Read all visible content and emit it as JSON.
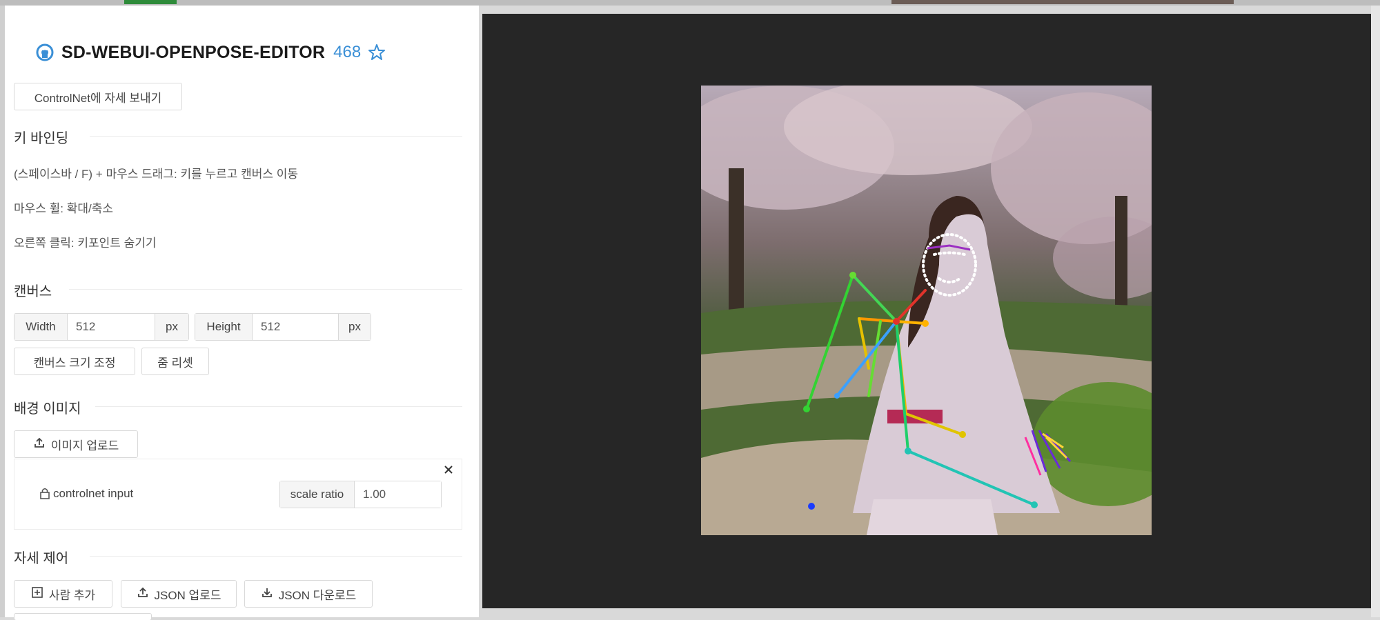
{
  "header": {
    "title": "SD-WEBUI-OPENPOSE-EDITOR",
    "stars": "468",
    "github_icon": "github-icon",
    "star_icon": "star-outline-icon"
  },
  "send_button": "ControlNet에 자세 보내기",
  "keybinding": {
    "title": "키 바인딩",
    "lines": [
      "(스페이스바 / F) + 마우스 드래그: 키를 누르고 캔버스 이동",
      "마우스 휠: 확대/축소",
      "오른쪽 클릭: 키포인트 숨기기"
    ]
  },
  "canvas": {
    "title": "캔버스",
    "width_label": "Width",
    "width_value": "512",
    "height_label": "Height",
    "height_value": "512",
    "unit": "px",
    "resize_button": "캔버스 크기 조정",
    "zoom_reset_button": "줌 리셋"
  },
  "background": {
    "title": "배경 이미지",
    "upload_button": "이미지 업로드",
    "card": {
      "layer_name": "controlnet input",
      "scale_label": "scale ratio",
      "scale_value": "1.00",
      "close_icon": "close-icon",
      "lock_icon": "lock-icon"
    }
  },
  "pose": {
    "title": "자세 제어",
    "add_person_button": "사람 추가",
    "json_upload_button": "JSON 업로드",
    "json_download_button": "JSON 다운로드"
  },
  "colors": {
    "accent": "#3a8fd6",
    "canvas_bg": "#262626"
  }
}
